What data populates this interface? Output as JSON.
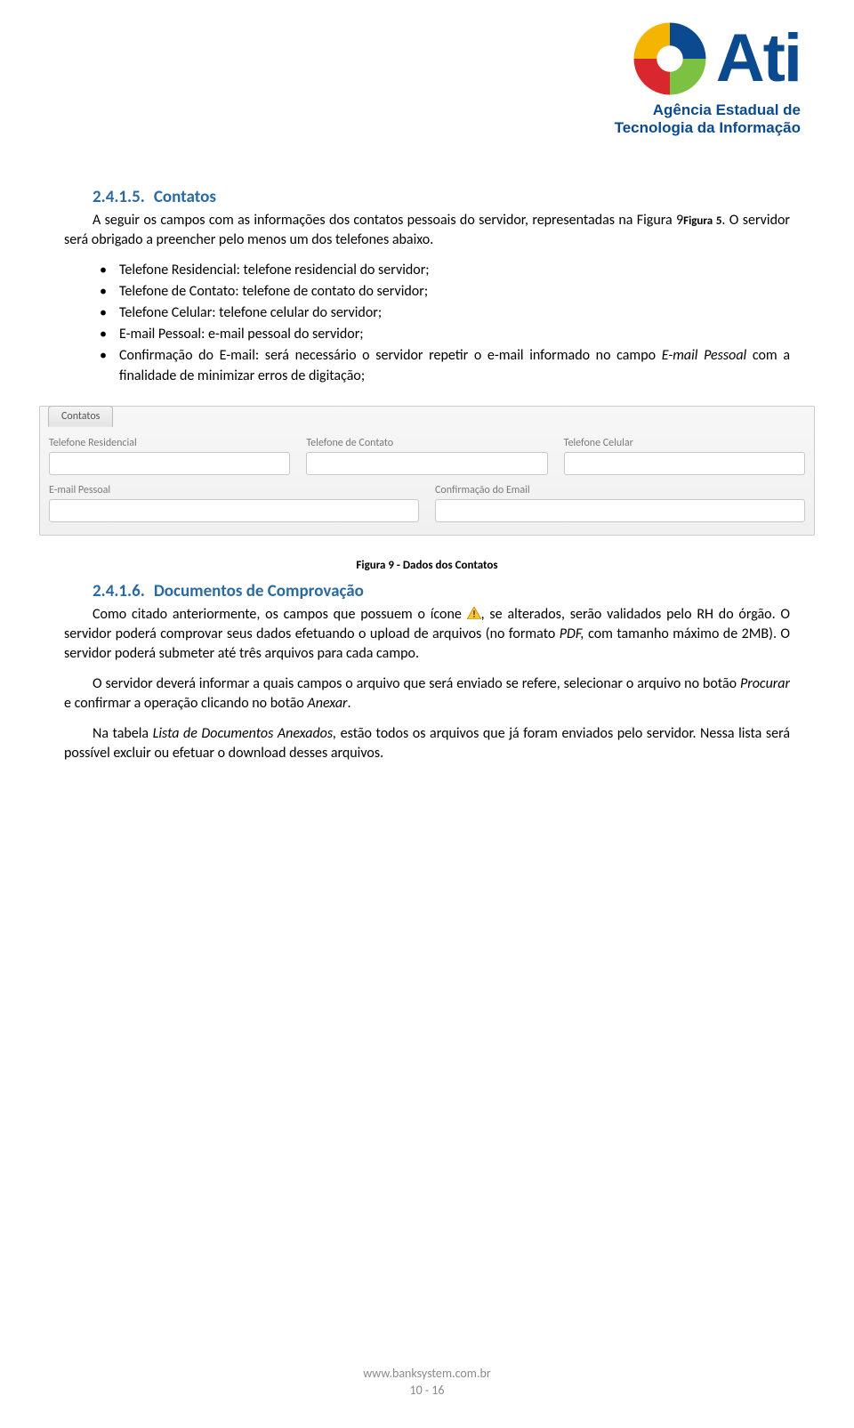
{
  "logo": {
    "name": "Ati",
    "sub1": "Agência Estadual de",
    "sub2": "Tecnologia da Informação"
  },
  "section1": {
    "number": "2.4.1.5.",
    "title": "Contatos",
    "p1a": "A seguir os campos com as informações dos contatos pessoais do servidor, representadas na Figura 9",
    "p1b": "Figura 5",
    "p1c": ". O servidor será obrigado a preencher pelo menos um dos telefones abaixo.",
    "bullets": [
      "Telefone Residencial: telefone residencial do servidor;",
      "Telefone de Contato: telefone de contato do servidor;",
      "Telefone Celular: telefone celular do servidor;",
      "E-mail Pessoal: e-mail pessoal do servidor;"
    ],
    "bullet5_a": "Confirmação do E-mail: será necessário o servidor repetir o e-mail informado no campo ",
    "bullet5_b": "E-mail Pessoal",
    "bullet5_c": " com a finalidade de minimizar erros de digitação;"
  },
  "form": {
    "tab": "Contatos",
    "labels": {
      "telres": "Telefone Residencial",
      "telcon": "Telefone de Contato",
      "telcel": "Telefone Celular",
      "email": "E-mail Pessoal",
      "emailconf": "Confirmação do Email"
    }
  },
  "figcaption": "Figura 9 - Dados dos Contatos",
  "section2": {
    "number": "2.4.1.6.",
    "title": "Documentos de Comprovação",
    "p1a": "Como citado anteriormente, os campos que possuem o ícone ",
    "p1b": ", se alterados, serão validados pelo RH do órgão. O servidor poderá comprovar seus dados efetuando o upload de arquivos (no formato ",
    "p1c": "PDF,",
    "p1d": " com tamanho máximo de 2MB). O servidor poderá submeter até três arquivos para cada campo.",
    "p2a": "O servidor deverá informar a quais campos o arquivo que será enviado se refere, selecionar o arquivo no botão ",
    "p2b": "Procurar",
    "p2c": " e confirmar a operação clicando no botão ",
    "p2d": "Anexar",
    "p2e": ".",
    "p3a": "Na tabela ",
    "p3b": "Lista de Documentos Anexados,",
    "p3c": " estão todos os arquivos que já foram enviados pelo servidor. Nessa lista será possível excluir ou efetuar o download desses arquivos."
  },
  "footer": {
    "url": "www.banksystem.com.br",
    "page": "10 - 16"
  }
}
